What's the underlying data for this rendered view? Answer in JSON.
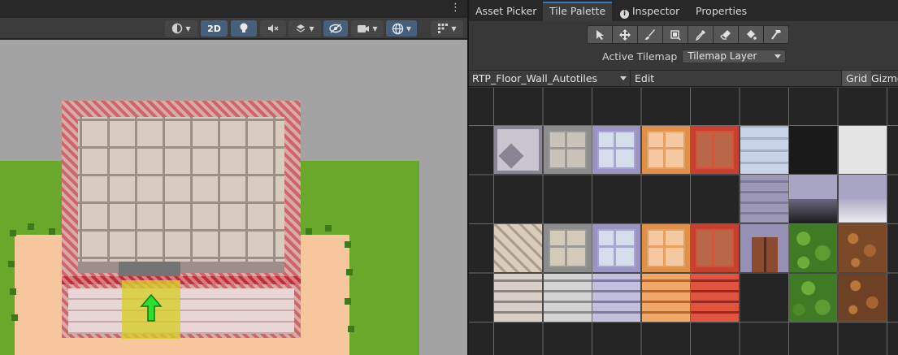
{
  "scene": {
    "menu_glyph": "⋮",
    "toolbar": {
      "mode_2d_label": "2D",
      "buttons": [
        {
          "name": "shading-mode-icon",
          "active": false
        },
        {
          "name": "2d-toggle",
          "active": true
        },
        {
          "name": "lighting-icon",
          "active": true
        },
        {
          "name": "audio-mute-icon",
          "active": false
        },
        {
          "name": "effects-icon",
          "active": false
        },
        {
          "name": "hidden-objects-icon",
          "active": true
        },
        {
          "name": "camera-icon",
          "active": false
        },
        {
          "name": "gizmos-globe-icon",
          "active": true
        },
        {
          "name": "grid-snap-icon",
          "active": false
        }
      ]
    }
  },
  "tabs": [
    {
      "label": "Asset Picker",
      "active": false
    },
    {
      "label": "Tile Palette",
      "active": true
    },
    {
      "label": "Inspector",
      "active": false,
      "icon": "info-icon"
    },
    {
      "label": "Properties",
      "active": false
    }
  ],
  "tools": [
    "select-tool-icon",
    "move-tool-icon",
    "paint-brush-icon",
    "box-fill-icon",
    "eyedropper-icon",
    "eraser-icon",
    "flood-fill-icon",
    "hammer-icon"
  ],
  "active_tilemap": {
    "label": "Active Tilemap",
    "value": "Tilemap Layer"
  },
  "palette_bar": {
    "palette_name": "RTP_Floor_Wall_Autotiles",
    "edit_label": "Edit",
    "grid_label": "Grid",
    "gizmos_label": "Gizmos"
  },
  "colors": {
    "accent_tab": "#3a79bb",
    "toggle_active": "#46607c",
    "grass": "#6aa82b",
    "sand": "#f6c79c",
    "wall_red": "#c03c43",
    "selection_yellow": "#d7cd28",
    "arrow_green": "#2ee02e"
  }
}
